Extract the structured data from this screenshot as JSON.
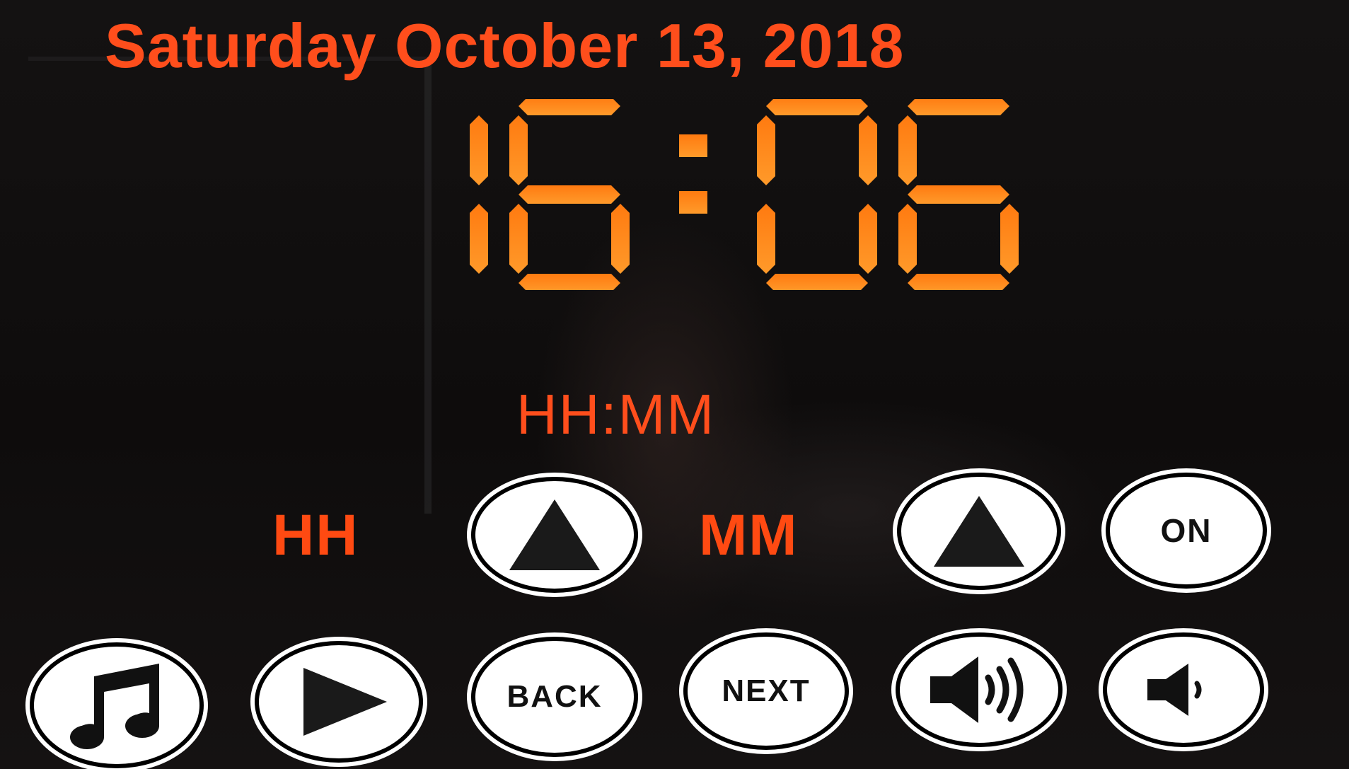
{
  "screen": {
    "date": "Saturday October 13, 2018",
    "time": {
      "hours": "16",
      "separator": ":",
      "minutes": "06"
    },
    "format_label": "HH:MM",
    "colors": {
      "accent": "#ff4e1c",
      "clock_digits": "#ff8a1a",
      "button_face": "#ffffff"
    }
  },
  "set_time": {
    "hour_label": "HH",
    "minute_label": "MM",
    "hour_up_icon": "triangle-up-icon",
    "minute_up_icon": "triangle-up-icon",
    "on_label": "ON"
  },
  "media_controls": {
    "music_icon": "music-note-icon",
    "play_icon": "play-icon",
    "back_label": "BACK",
    "next_label": "NEXT",
    "volume_up_icon": "speaker-loud-icon",
    "volume_down_icon": "speaker-quiet-icon"
  }
}
